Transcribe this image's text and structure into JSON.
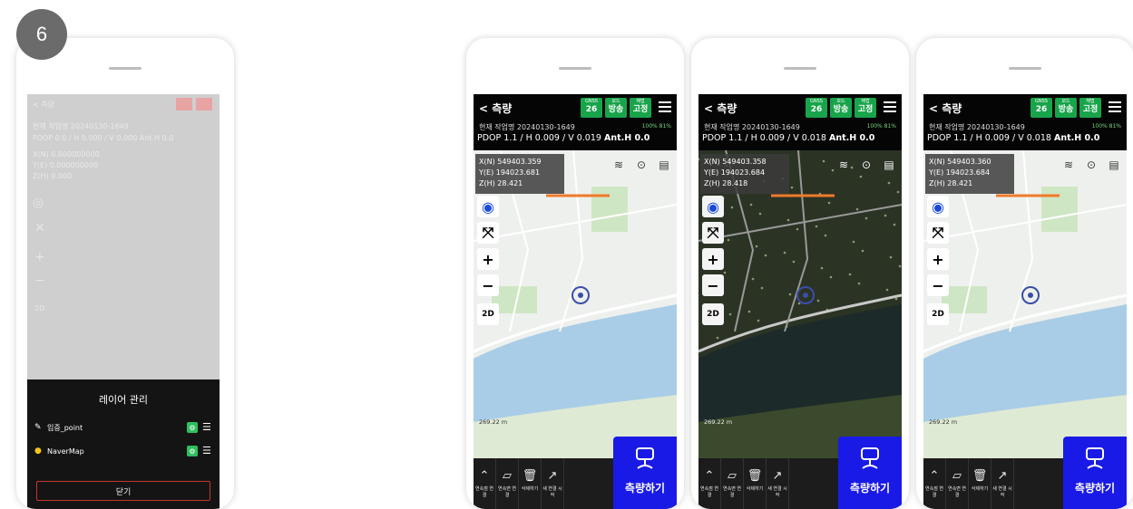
{
  "step_number": "6",
  "overlay": {
    "back_label": "< 측량",
    "ghost_lines": [
      "현재 작업명 20240130-1649",
      "PDOP 0.0 / H 0.000 / V 0.000  Ant.H 0.0",
      "X(N) 0.000000000",
      "Y(E) 0.000000000",
      "Z(H) 0.000"
    ],
    "layer_panel": {
      "title": "레이어 관리",
      "items": [
        {
          "icon": "pen-icon",
          "name": "입증_point"
        },
        {
          "icon": "bulb-icon",
          "name": "NaverMap"
        }
      ],
      "close_label": "닫기"
    }
  },
  "phones": [
    {
      "back_label": "< 측량",
      "chips": [
        {
          "label": "GNSS",
          "value": "26"
        },
        {
          "label": "모드",
          "value": "방송"
        },
        {
          "label": "해법",
          "value": "고정"
        }
      ],
      "job_line": "현재 작업명 20240130-1649",
      "battery": "100%  81%",
      "pdop": "PDOP 1.1 / H 0.009 / V 0.019",
      "anth": "Ant.H 0.0",
      "coords": {
        "x": "X(N) 549403.359",
        "y": "Y(E) 194023.681",
        "z": "Z(H) 28.421"
      },
      "scale": "269.22 m",
      "map_style": "normal"
    },
    {
      "back_label": "< 측량",
      "chips": [
        {
          "label": "GNSS",
          "value": "26"
        },
        {
          "label": "모드",
          "value": "방송"
        },
        {
          "label": "해법",
          "value": "고정"
        }
      ],
      "job_line": "현재 작업명 20240130-1649",
      "battery": "100%  81%",
      "pdop": "PDOP 1.1 / H 0.009 / V 0.018",
      "anth": "Ant.H 0.0",
      "coords": {
        "x": "X(N) 549403.358",
        "y": "Y(E) 194023.684",
        "z": "Z(H) 28.418"
      },
      "scale": "269.22 m",
      "map_style": "satellite"
    },
    {
      "back_label": "< 측량",
      "chips": [
        {
          "label": "GNSS",
          "value": "26"
        },
        {
          "label": "모드",
          "value": "방송"
        },
        {
          "label": "해법",
          "value": "고정"
        }
      ],
      "job_line": "현재 작업명 20240130-1649",
      "battery": "100%  81%",
      "pdop": "PDOP 1.1 / H 0.009 / V 0.018",
      "anth": "Ant.H 0.0",
      "coords": {
        "x": "X(N) 549403.360",
        "y": "Y(E) 194023.684",
        "z": "Z(H) 28.421"
      },
      "scale": "269.22 m",
      "map_style": "normal"
    }
  ],
  "bottom_tools": [
    "연속점 연결",
    "연속면 연결",
    "삭제하기",
    "새 연결 시작"
  ],
  "measure_label": "측량하기",
  "map_colors": {
    "land": "#eef0ee",
    "water": "#a9cde6",
    "green": "#cfe6c4",
    "road": "#ffffff",
    "sat_land": "#2b3325",
    "sat_water": "#1d2a2a",
    "route": "#f07a2a"
  }
}
